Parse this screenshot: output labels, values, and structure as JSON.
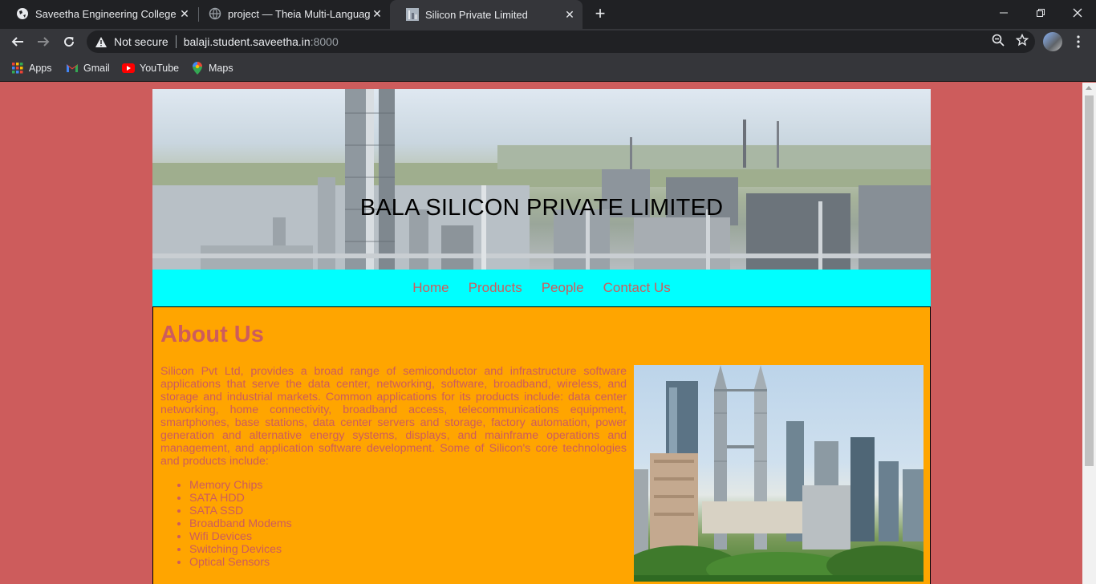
{
  "browser": {
    "tabs": [
      {
        "title": "Saveetha Engineering College",
        "active": false
      },
      {
        "title": "project — Theia Multi-Language",
        "active": false
      },
      {
        "title": "Silicon Private Limited",
        "active": true
      }
    ],
    "address": {
      "security_label": "Not secure",
      "host": "balaji.student.saveetha.in",
      "port": ":8000"
    },
    "bookmarks": [
      "Apps",
      "Gmail",
      "YouTube",
      "Maps"
    ],
    "colors": {
      "chrome_dark": "#202124",
      "chrome_toolbar": "#35363a",
      "chrome_text": "#e8eaed"
    }
  },
  "page": {
    "colors": {
      "background": "#cd5c5c",
      "nav_background": "#00ffff",
      "content_background": "#ffa500",
      "text": "#cd5c5c"
    },
    "banner_title": "BALA SILICON PRIVATE LIMITED",
    "nav": [
      "Home",
      "Products",
      "People",
      "Contact Us"
    ],
    "about": {
      "heading": "About Us",
      "paragraph": "Silicon Pvt Ltd, provides a broad range of semiconductor and infrastructure software applications that serve the data center, networking, software, broadband, wireless, and storage and industrial markets. Common applications for its products include: data center networking, home connectivity, broadband access, telecommunications equipment, smartphones, base stations, data center servers and storage, factory automation, power generation and alternative energy systems, displays, and mainframe operations and management, and application software development. Some of Silicon's core technologies and products include:",
      "products": [
        "Memory Chips",
        "SATA HDD",
        "SATA SSD",
        "Broadband Modems",
        "Wifi Devices",
        "Switching Devices",
        "Optical Sensors"
      ]
    }
  }
}
